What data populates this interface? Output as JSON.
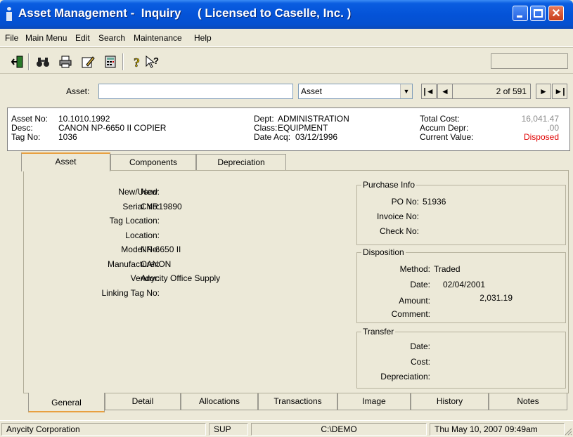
{
  "window": {
    "title": "Asset Management -  Inquiry     ( Licensed to Caselle, Inc. )"
  },
  "menu": [
    "File",
    "Main Menu",
    "Edit",
    "Search",
    "Maintenance",
    "Help"
  ],
  "toolbar": {
    "icons": [
      "exit-icon",
      "find-icon",
      "print-icon",
      "edit-icon",
      "calculator-icon",
      "help-icon",
      "context-help-icon"
    ]
  },
  "search": {
    "asset_label": "Asset:",
    "asset_value": "",
    "search_type": "Asset",
    "record_position": "2 of 591",
    "nav_first": "|◄",
    "nav_prev": "◄",
    "nav_next": "►",
    "nav_last": "►|"
  },
  "header": {
    "asset_no_label": "Asset No:",
    "asset_no": "10.1010.1992",
    "desc_label": "Desc:",
    "desc": "CANON NP-6650 II COPIER",
    "tag_no_label": "Tag No:",
    "tag_no": "1036",
    "dept_label": "Dept:",
    "dept": "ADMINISTRATION",
    "class_label": "Class:",
    "class": "EQUIPMENT",
    "date_acq_label": "Date Acq:",
    "date_acq": "03/12/1996",
    "total_cost_label": "Total Cost:",
    "total_cost": "16,041.47",
    "accum_depr_label": "Accum Depr:",
    "accum_depr": ".00",
    "current_value_label": "Current Value:",
    "current_value": "Disposed"
  },
  "top_tabs": [
    "Asset",
    "Components",
    "Depreciation"
  ],
  "details": {
    "new_used_label": "New/Used:",
    "new_used": "New",
    "serial_no_label": "Serial No:",
    "serial_no": "CYR19890",
    "tag_location_label": "Tag Location:",
    "tag_location": "",
    "location_label": "Location:",
    "location": "",
    "model_no_label": "Model No:",
    "model_no": "NP-6650 II",
    "manufacturer_label": "Manufacturer:",
    "manufacturer": "CANON",
    "vendor_label": "Vendor:",
    "vendor": "Anycity Office Supply",
    "linking_tag_label": "Linking Tag No:",
    "linking_tag": ""
  },
  "purchase": {
    "title": "Purchase Info",
    "po_no_label": "PO No:",
    "po_no": "51936",
    "invoice_no_label": "Invoice No:",
    "invoice_no": "",
    "check_no_label": "Check No:",
    "check_no": ""
  },
  "disposition": {
    "title": "Disposition",
    "method_label": "Method:",
    "method": "Traded",
    "date_label": "Date:",
    "date": "02/04/2001",
    "amount_label": "Amount:",
    "amount": "2,031.19",
    "comment_label": "Comment:",
    "comment": ""
  },
  "transfer": {
    "title": "Transfer",
    "date_label": "Date:",
    "cost_label": "Cost:",
    "depreciation_label": "Depreciation:"
  },
  "bottom_tabs": [
    "General",
    "Detail",
    "Allocations",
    "Transactions",
    "Image",
    "History",
    "Notes"
  ],
  "status": {
    "company": "Anycity Corporation",
    "user": "SUP",
    "path": "C:\\DEMO",
    "datetime": "Thu May 10, 2007  09:49am"
  },
  "colors": {
    "titlebar": "#0453d8",
    "disposed": "#e00000",
    "active_tab_accent": "#e8a040"
  }
}
